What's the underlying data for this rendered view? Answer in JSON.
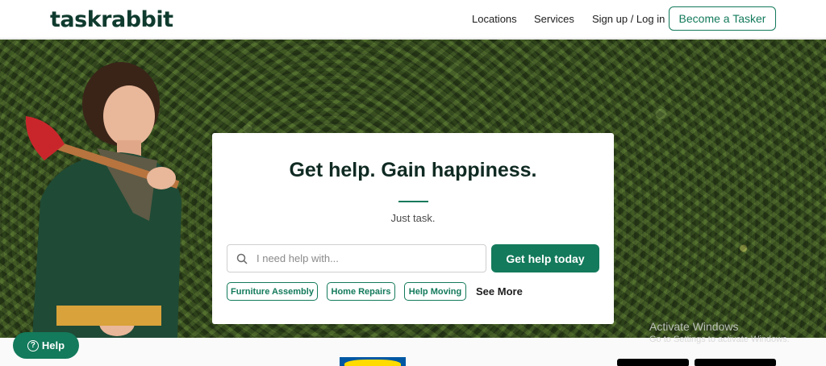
{
  "header": {
    "logo": "taskrabbit",
    "nav": {
      "locations": "Locations",
      "services": "Services",
      "signup": "Sign up / Log in"
    },
    "become_tasker": "Become a Tasker"
  },
  "hero": {
    "title": "Get help. Gain happiness.",
    "subtitle": "Just task.",
    "search": {
      "placeholder": "I need help with..."
    },
    "cta": "Get help today",
    "chips": [
      "Furniture Assembly",
      "Home Repairs",
      "Help Moving"
    ],
    "see_more": "See More"
  },
  "help_button": "Help",
  "watermark": {
    "title": "Activate Windows",
    "subtitle": "Go to Settings to activate Windows."
  },
  "colors": {
    "brand_green": "#137a5b",
    "logo_dark": "#0f3b2e"
  },
  "icons": {
    "search": "search-icon",
    "help": "question-circle-icon"
  }
}
